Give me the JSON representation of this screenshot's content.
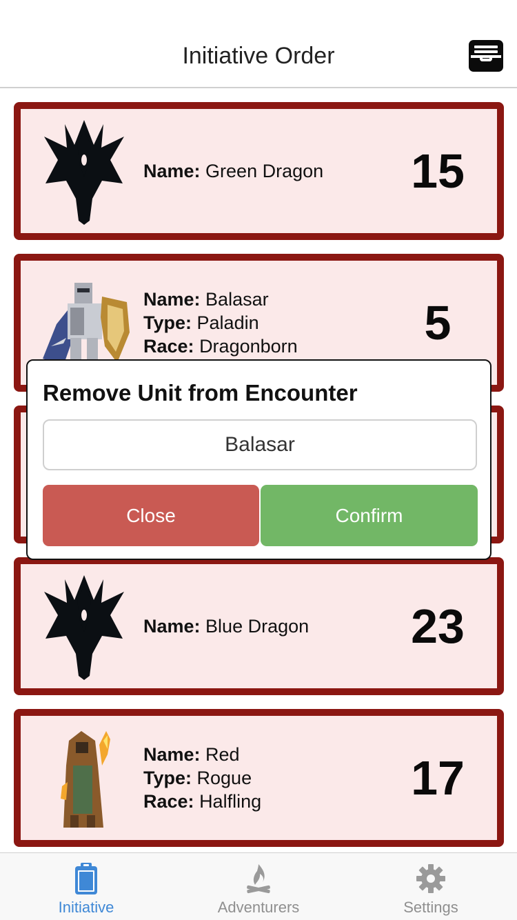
{
  "header": {
    "title": "Initiative Order",
    "action_icon": "inbox-tray-icon"
  },
  "cards": [
    {
      "portrait_icon": "dragon-emblem-icon",
      "name_label": "Name:",
      "name": "Green Dragon",
      "type_label": "",
      "type": "",
      "race_label": "",
      "race": "",
      "initiative": "15"
    },
    {
      "portrait_icon": "knight-sprite-icon",
      "name_label": "Name:",
      "name": "Balasar",
      "type_label": "Type:",
      "type": "Paladin",
      "race_label": "Race:",
      "race": "Dragonborn",
      "initiative": "5"
    },
    {
      "portrait_icon": "hidden",
      "name_label": "",
      "name": "",
      "type_label": "",
      "type": "",
      "race_label": "",
      "race": "",
      "initiative": ""
    },
    {
      "portrait_icon": "dragon-emblem-icon",
      "name_label": "Name:",
      "name": "Blue Dragon",
      "type_label": "",
      "type": "",
      "race_label": "",
      "race": "",
      "initiative": "23"
    },
    {
      "portrait_icon": "rogue-sprite-icon",
      "name_label": "Name:",
      "name": "Red",
      "type_label": "Type:",
      "type": "Rogue",
      "race_label": "Race:",
      "race": "Halfling",
      "initiative": "17"
    }
  ],
  "modal": {
    "title": "Remove Unit from Encounter",
    "field_value": "Balasar",
    "close_label": "Close",
    "confirm_label": "Confirm"
  },
  "tabbar": {
    "tabs": [
      {
        "label": "Initiative",
        "icon": "clipboard-icon",
        "active": true
      },
      {
        "label": "Adventurers",
        "icon": "campfire-icon",
        "active": false
      },
      {
        "label": "Settings",
        "icon": "gear-icon",
        "active": false
      }
    ]
  },
  "colors": {
    "card_border": "#8b1712",
    "card_bg": "#fbe9e9",
    "close_button": "#c95a53",
    "confirm_button": "#72b766",
    "active_tab": "#3f88d6",
    "inactive_tab": "#8f8f8f"
  }
}
